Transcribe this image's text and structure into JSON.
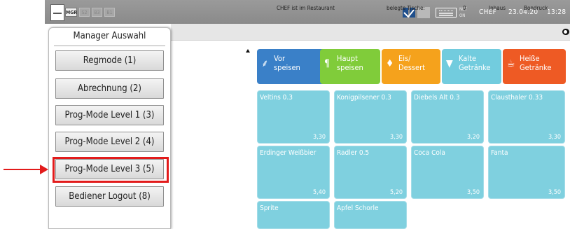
{
  "topbar": {
    "mode_buttons": [
      "MGR",
      "S2",
      "B3",
      "B1"
    ],
    "net_label_1": "NET",
    "net_label_2": "ON",
    "user": "CHEF",
    "date": "23.04.20",
    "time": "13:28",
    "colors": {
      "bar": "#8f8f8f"
    },
    "icons": [
      "app-logo-icon",
      "network-status-icon",
      "keyboard-icon"
    ]
  },
  "status": {
    "location": "CHEF ist im Restaurant",
    "tables_label": "belegte Tische:",
    "tables_count": "0",
    "mode": "Inhaus",
    "print": "Bondruck"
  },
  "manager_menu": {
    "title": "Manager Auswahl",
    "items": [
      "Regmode (1)",
      "Abrechnung (2)",
      "Prog-Mode Level 1 (3)",
      "Prog-Mode Level 2 (4)",
      "Prog-Mode Level 3 (5)",
      "Bediener Logout (8)"
    ],
    "highlighted_index": 4,
    "highlight_color": "#e21b1b"
  },
  "categories": [
    {
      "line1": "Vor",
      "line2": "speisen",
      "color": "#3a80c8",
      "icon": "spoon-icon"
    },
    {
      "line1": "Haupt",
      "line2": "speisen",
      "color": "#80cc3a",
      "icon": "cutlery-icon"
    },
    {
      "line1": "Eis/",
      "line2": "Dessert",
      "color": "#f5a21c",
      "icon": "ice-cream-icon"
    },
    {
      "line1": "Kalte",
      "line2": "Getränke",
      "color": "#72ccde",
      "icon": "glass-icon"
    },
    {
      "line1": "Heiße",
      "line2": "Getränke",
      "color": "#ee5a24",
      "icon": "coffee-cup-icon"
    }
  ],
  "products": [
    {
      "name": "Veltins 0.3",
      "price": "3,30"
    },
    {
      "name": "Konigpilsener 0.3",
      "price": "3,30"
    },
    {
      "name": "Diebels Alt 0.3",
      "price": "3,20"
    },
    {
      "name": "Clausthaler 0.33",
      "price": "3,30"
    },
    {
      "name": "Erdinger Weißbier",
      "price": "5,40"
    },
    {
      "name": "Radler 0.5",
      "price": "5,20"
    },
    {
      "name": "Coca Cola",
      "price": "3,50"
    },
    {
      "name": "Fanta",
      "price": "3,50"
    },
    {
      "name": "Sprite",
      "price": ""
    },
    {
      "name": "Apfel Schorle",
      "price": ""
    }
  ],
  "tile_color": "#7fd0df"
}
